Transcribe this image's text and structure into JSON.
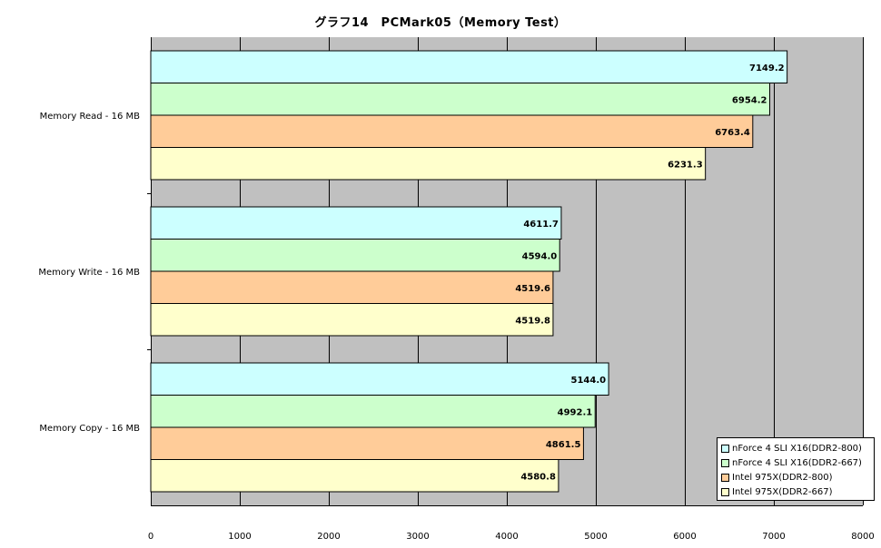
{
  "chart_data": {
    "type": "bar",
    "orientation": "horizontal",
    "title": "グラフ14　PCMark05（Memory Test）",
    "categories": [
      "Memory Read - 16 MB",
      "Memory Write - 16 MB",
      "Memory Copy - 16 MB"
    ],
    "series": [
      {
        "name": "nForce 4 SLI X16(DDR2-800)",
        "color": "#ccffff",
        "values": [
          7149.2,
          4611.7,
          5144.0
        ]
      },
      {
        "name": "nForce 4 SLI X16(DDR2-667)",
        "color": "#ccffcc",
        "values": [
          6954.2,
          4594.0,
          4992.1
        ]
      },
      {
        "name": "Intel 975X(DDR2-800)",
        "color": "#ffcc99",
        "values": [
          6763.4,
          4519.6,
          4861.5
        ]
      },
      {
        "name": "Intel 975X(DDR2-667)",
        "color": "#ffffcc",
        "values": [
          6231.3,
          4519.8,
          4580.8
        ]
      }
    ],
    "xlim": [
      0,
      8000
    ],
    "xticks": [
      0,
      1000,
      2000,
      3000,
      4000,
      5000,
      6000,
      7000,
      8000
    ],
    "grid": true,
    "plot_background": "#c0c0c0",
    "legend_position": "bottom-right"
  }
}
